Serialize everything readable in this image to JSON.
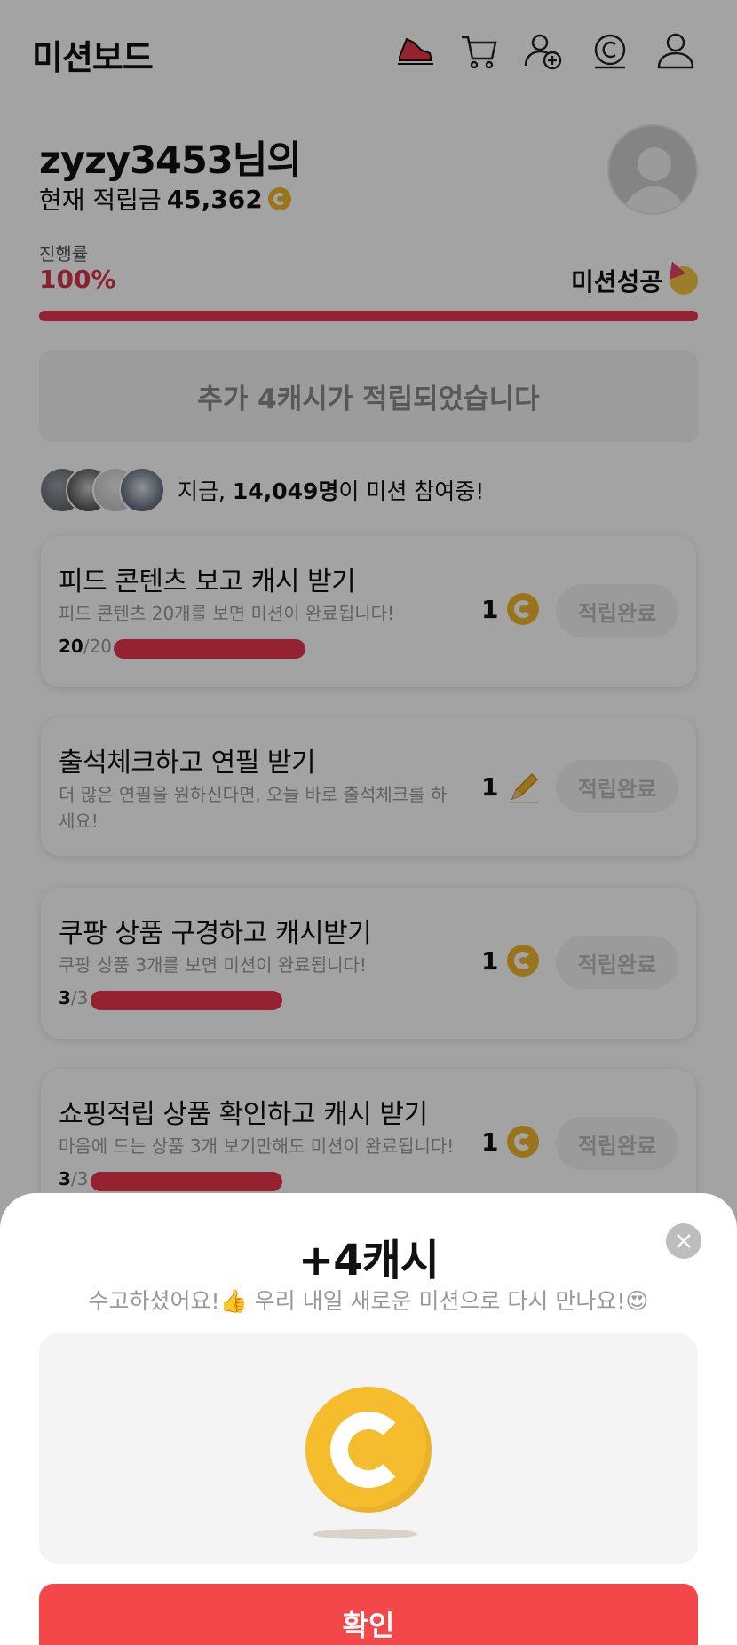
{
  "header": {
    "title": "미션보드",
    "icons": [
      "sneaker-icon",
      "cart-icon",
      "add-friend-icon",
      "cash-icon",
      "profile-icon"
    ]
  },
  "profile": {
    "username": "zyzy3453님의",
    "balance_label": "현재 적립금",
    "balance_value": "45,362"
  },
  "progress": {
    "label": "진행률",
    "percent_text": "100%",
    "percent_value": 1.0,
    "status": "미션성공"
  },
  "notice": "추가 4캐시가 적립되었습니다",
  "participants": {
    "prefix": "지금, ",
    "count": "14,049명",
    "suffix": "이 미션 참여중!"
  },
  "missions": [
    {
      "title": "피드 콘텐츠 보고 캐시 받기",
      "desc": "피드 콘텐츠 20개를 보면 미션이 완료됩니다!",
      "done": "20",
      "total": "/20",
      "fill": 1.0,
      "reward": "1",
      "reward_icon": "coin-icon",
      "button": "적립완료"
    },
    {
      "title": "출석체크하고 연필 받기",
      "desc": "더 많은 연필을 원하신다면, 오늘 바로 출석체크를 하세요!",
      "reward": "1",
      "reward_icon": "pencil-icon",
      "button": "적립완료"
    },
    {
      "title": "쿠팡 상품 구경하고 캐시받기",
      "desc": "쿠팡 상품 3개를 보면 미션이 완료됩니다!",
      "done": "3",
      "total": "/3",
      "fill": 1.0,
      "reward": "1",
      "reward_icon": "coin-icon",
      "button": "적립완료"
    },
    {
      "title": "쇼핑적립 상품 확인하고 캐시 받기",
      "desc": "마음에 드는 상품 3개 보기만해도 미션이 완료됩니다!",
      "done": "3",
      "total": "/3",
      "fill": 1.0,
      "reward": "1",
      "reward_icon": "coin-icon",
      "button": "적립완료"
    }
  ],
  "modal": {
    "title": "+4캐시",
    "subtitle": "수고하셨어요!👍 우리 내일 새로운 미션으로 다시 만나요!😍",
    "confirm": "확인"
  },
  "colors": {
    "accent": "#e8364d",
    "button": "#f4474a",
    "coin": "#f0b62b"
  }
}
